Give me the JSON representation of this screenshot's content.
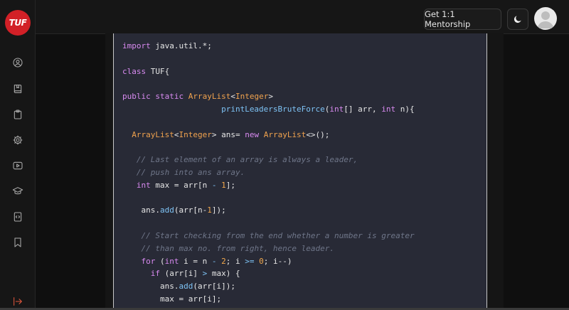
{
  "brand": {
    "logo_text": "TUF",
    "accent": "#d22027"
  },
  "header": {
    "mentorship_label": "Get 1:1 Mentorship",
    "theme_icon": "moon-icon",
    "avatar_icon": "user-avatar"
  },
  "sidebar": {
    "items": [
      {
        "icon": "user-circle-icon"
      },
      {
        "icon": "book-icon"
      },
      {
        "icon": "clipboard-icon"
      },
      {
        "icon": "gear-icon"
      },
      {
        "icon": "play-icon"
      },
      {
        "icon": "graduation-cap-icon"
      },
      {
        "icon": "code-file-icon"
      },
      {
        "icon": "bookmark-icon"
      }
    ],
    "collapse_icon": "arrow-right-icon"
  },
  "code": {
    "lines": [
      {
        "html": "<span class=\"kw\">import</span> java.util.*;"
      },
      {
        "html": ""
      },
      {
        "html": "<span class=\"kw\">class</span> TUF{"
      },
      {
        "html": ""
      },
      {
        "html": "<span class=\"kw\">public</span> <span class=\"kw\">static</span> <span class=\"ty\">ArrayList</span>&lt;<span class=\"ty\">Integer</span>&gt;"
      },
      {
        "html": "                     <span class=\"fn\">printLeadersBruteForce</span>(<span class=\"kw\">int</span>[] arr, <span class=\"kw\">int</span> n){"
      },
      {
        "html": ""
      },
      {
        "html": "  <span class=\"ty\">ArrayList</span>&lt;<span class=\"ty\">Integer</span>&gt; ans= <span class=\"kw\">new</span> <span class=\"ty\">ArrayList</span>&lt;&gt;();"
      },
      {
        "html": ""
      },
      {
        "html": "   <span class=\"cm\">// Last element of an array is always a leader,</span>"
      },
      {
        "html": "   <span class=\"cm\">// push into ans array.</span>"
      },
      {
        "html": "   <span class=\"kw\">int</span> max = arr[n <span class=\"op\">-</span> <span class=\"nm\">1</span>];"
      },
      {
        "html": ""
      },
      {
        "html": "    ans.<span class=\"fn\">add</span>(arr[n-<span class=\"nm\">1</span>]);"
      },
      {
        "html": ""
      },
      {
        "html": "    <span class=\"cm\">// Start checking from the end whether a number is greater</span>"
      },
      {
        "html": "    <span class=\"cm\">// than max no. from right, hence leader.</span>"
      },
      {
        "html": "    <span class=\"kw\">for</span> (<span class=\"kw\">int</span> i = n <span class=\"op\">-</span> <span class=\"nm\">2</span>; i <span class=\"op\">&gt;=</span> <span class=\"nm\">0</span>; i--)"
      },
      {
        "html": "      <span class=\"kw\">if</span> (arr[i] <span class=\"op\">&gt;</span> max) {"
      },
      {
        "html": "        ans.<span class=\"fn\">add</span>(arr[i]);"
      },
      {
        "html": "        max = arr[i];"
      },
      {
        "html": "      }"
      }
    ]
  }
}
